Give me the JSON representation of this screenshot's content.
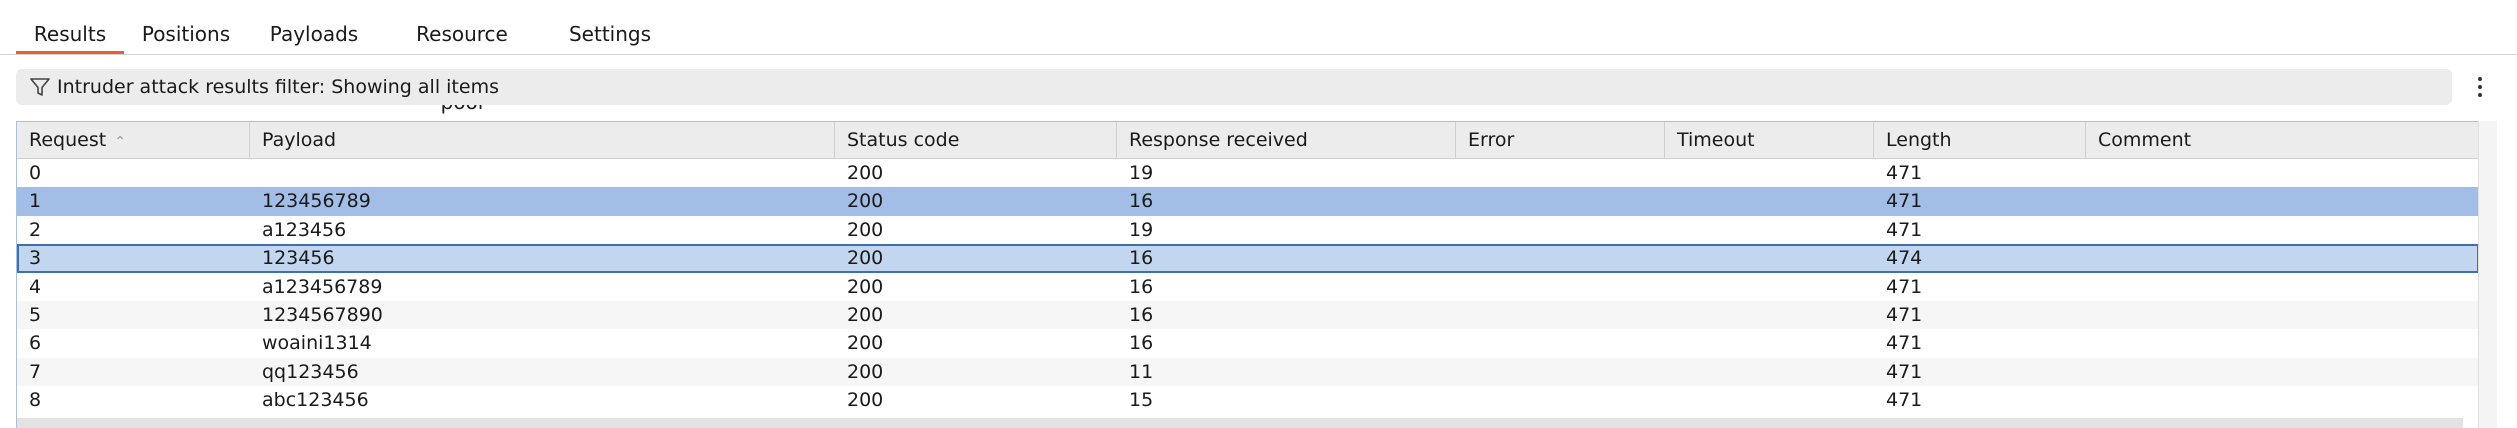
{
  "tabs": [
    {
      "label": "Results",
      "active": true
    },
    {
      "label": "Positions",
      "active": false
    },
    {
      "label": "Payloads",
      "active": false
    },
    {
      "label": "Resource pool",
      "active": false
    },
    {
      "label": "Settings",
      "active": false
    }
  ],
  "filter": {
    "icon": "filter-icon",
    "text": "Intruder attack results filter: Showing all items"
  },
  "menu_icon": "kebab-menu-icon",
  "table": {
    "columns": [
      "Request",
      "Payload",
      "Status code",
      "Response received",
      "Error",
      "Timeout",
      "Length",
      "Comment"
    ],
    "sort": {
      "column": "Request",
      "direction": "ascending"
    },
    "rows": [
      {
        "request": "0",
        "payload": "",
        "status": "200",
        "response": "19",
        "error": "",
        "timeout": "",
        "length": "471",
        "comment": ""
      },
      {
        "request": "1",
        "payload": "123456789",
        "status": "200",
        "response": "16",
        "error": "",
        "timeout": "",
        "length": "471",
        "comment": ""
      },
      {
        "request": "2",
        "payload": "a123456",
        "status": "200",
        "response": "19",
        "error": "",
        "timeout": "",
        "length": "471",
        "comment": ""
      },
      {
        "request": "3",
        "payload": "123456",
        "status": "200",
        "response": "16",
        "error": "",
        "timeout": "",
        "length": "474",
        "comment": ""
      },
      {
        "request": "4",
        "payload": "a123456789",
        "status": "200",
        "response": "16",
        "error": "",
        "timeout": "",
        "length": "471",
        "comment": ""
      },
      {
        "request": "5",
        "payload": "1234567890",
        "status": "200",
        "response": "16",
        "error": "",
        "timeout": "",
        "length": "471",
        "comment": ""
      },
      {
        "request": "6",
        "payload": "woaini1314",
        "status": "200",
        "response": "16",
        "error": "",
        "timeout": "",
        "length": "471",
        "comment": ""
      },
      {
        "request": "7",
        "payload": "qq123456",
        "status": "200",
        "response": "11",
        "error": "",
        "timeout": "",
        "length": "471",
        "comment": ""
      },
      {
        "request": "8",
        "payload": "abc123456",
        "status": "200",
        "response": "15",
        "error": "",
        "timeout": "",
        "length": "471",
        "comment": ""
      }
    ]
  },
  "colors": {
    "accent": "#e8612c",
    "selected_row": "#a2bde6",
    "focused_row": "#c3d6ef",
    "focus_border": "#3f6fb0"
  }
}
